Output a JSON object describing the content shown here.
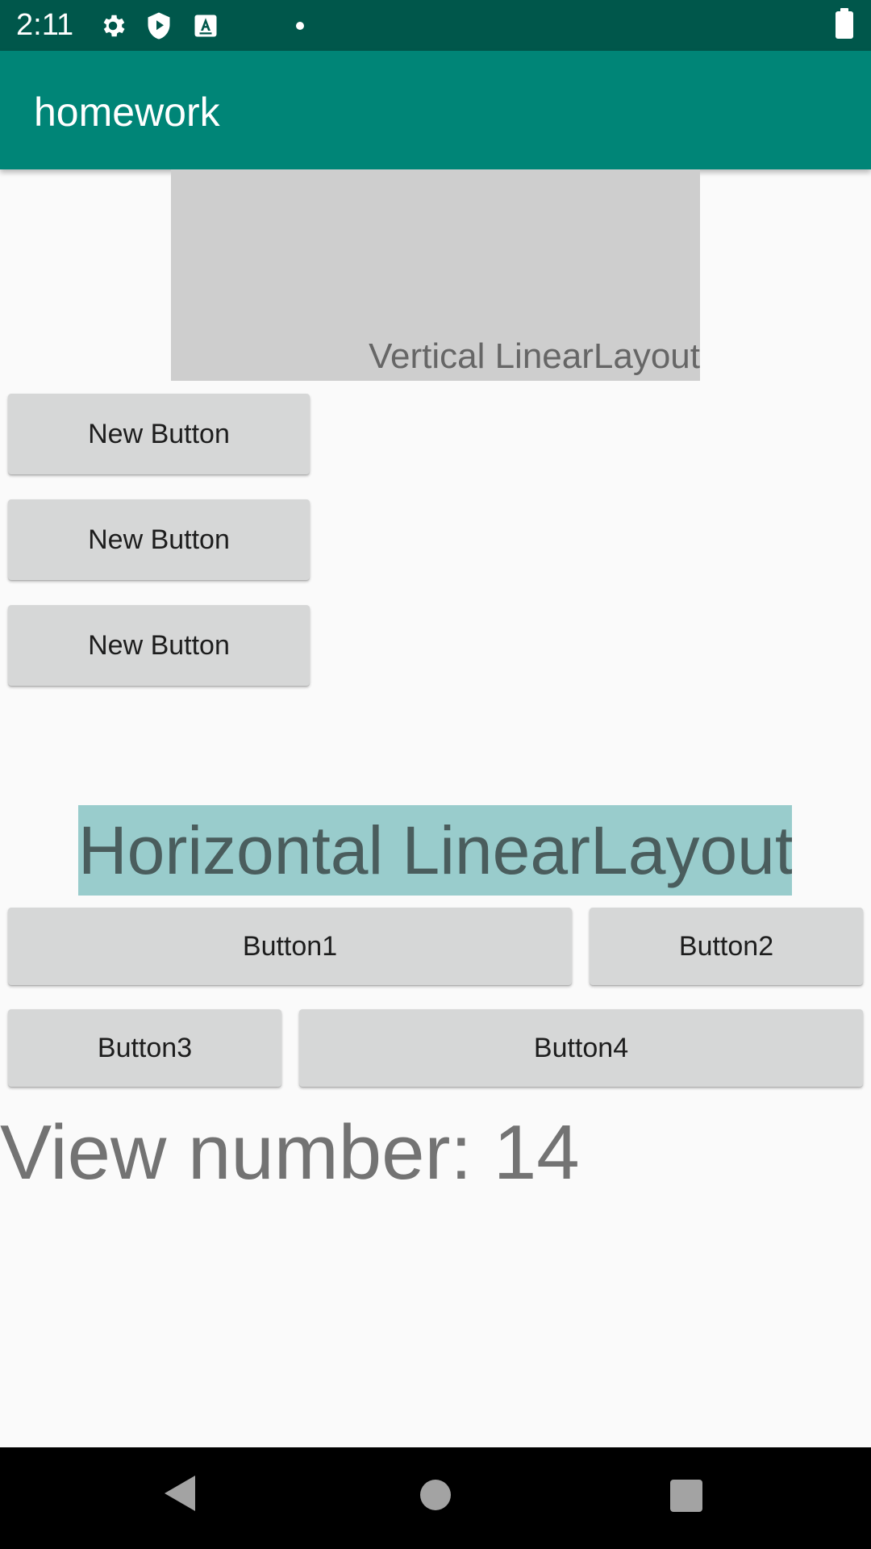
{
  "status_bar": {
    "time": "2:11",
    "icons": [
      "gear-icon",
      "shield-play-icon",
      "keyboard-a-icon",
      "notification-dot-icon",
      "battery-icon"
    ],
    "background": "#00574b"
  },
  "app_bar": {
    "title": "homework",
    "background": "#008577"
  },
  "vertical_header": {
    "label": "Vertical LinearLayout",
    "background": "#cecece"
  },
  "new_buttons": [
    "New Button",
    "New Button",
    "New Button"
  ],
  "horizontal_header": {
    "label": "Horizontal LinearLayout",
    "background": "#99cccc"
  },
  "buttons": {
    "button1": "Button1",
    "button2": "Button2",
    "button3": "Button3",
    "button4": "Button4"
  },
  "view_number": "View number: 14",
  "nav_bar": {
    "icons": [
      "back-icon",
      "home-icon",
      "recents-icon"
    ]
  }
}
